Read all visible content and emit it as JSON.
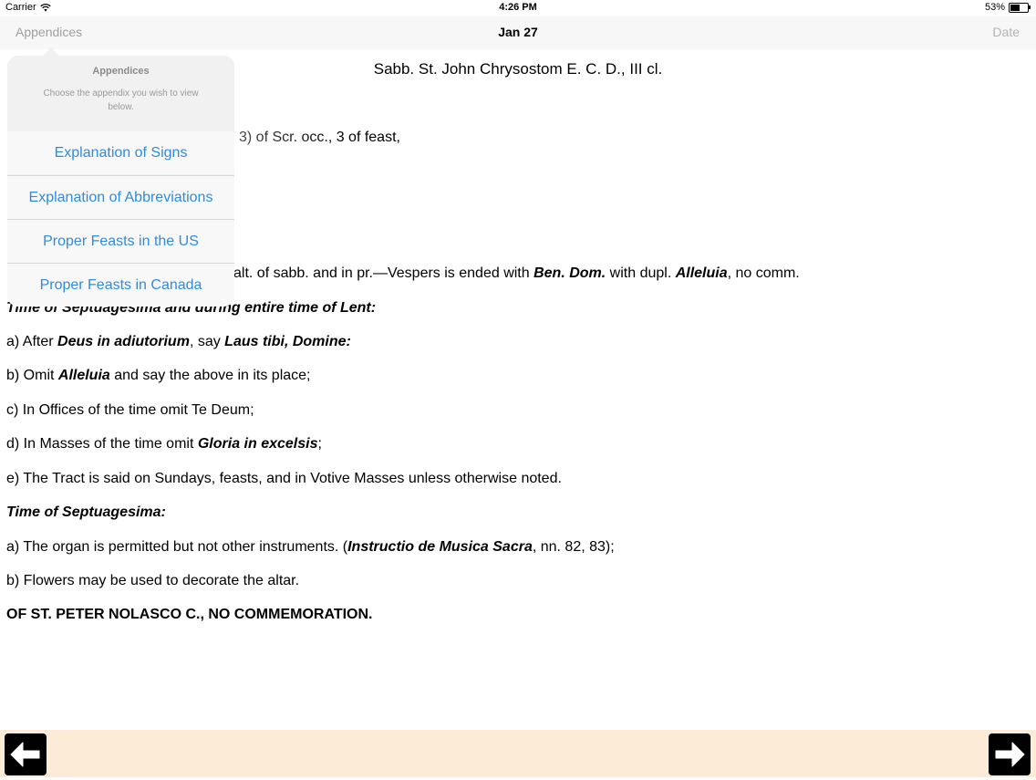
{
  "status": {
    "carrier": "Carrier",
    "time": "4:26 PM",
    "battery": "53%",
    "battery_level": 0.53
  },
  "nav": {
    "left": "Appendices",
    "title": "Jan 27",
    "right": "Date"
  },
  "doc": {
    "title": "Sabb. St. John Chrysostom E. C. D., III cl.",
    "line_feast": "3) of Scr. occ., 3 of feast,",
    "line_vespers": {
      "a": "alt. of sabb. and in pr.—Vespers is ended with ",
      "b": "Ben. Dom.",
      "c": " with dupl. ",
      "d": "Alleluia",
      "e": ", no comm."
    },
    "heading_lent": "Time of Septuagesima and during entire time of Lent:",
    "a1": {
      "p1": "a) After ",
      "b1": "Deus in adiutorium",
      "p2": ", say ",
      "b2": "Laus tibi, Domine:"
    },
    "b1": {
      "p1": "b) Omit ",
      "b1": "Alleluia",
      "p2": " and say the above in its place;"
    },
    "c1": "c) In Offices of the time omit Te Deum;",
    "d1": {
      "p1": "d) In Masses of the time omit ",
      "b1": "Gloria in excelsis",
      "p2": ";"
    },
    "e1": "e) The Tract is said on Sundays, feasts, and in Votive Masses unless otherwise noted.",
    "heading_sept": "Time of Septuagesima:",
    "a2": {
      "p1": "a) The organ is permitted but not other instruments. (",
      "b1": "Instructio de Musica Sacra",
      "p2": ", nn. 82, 83);"
    },
    "b2": "b) Flowers may be used to decorate the altar.",
    "final": "OF ST. PETER NOLASCO C., NO COMMEMORATION."
  },
  "popover": {
    "title": "Appendices",
    "message": "Choose the appendix you wish to view below.",
    "items": [
      "Explanation of Signs",
      "Explanation of Abbreviations",
      "Proper Feasts in the US",
      "Proper Feasts in Canada"
    ]
  },
  "colors": {
    "link": "#2f8bdf",
    "bottom_bar": "#fcecd7"
  },
  "icons": {
    "back": "left-arrow-icon",
    "forward": "right-arrow-icon"
  }
}
